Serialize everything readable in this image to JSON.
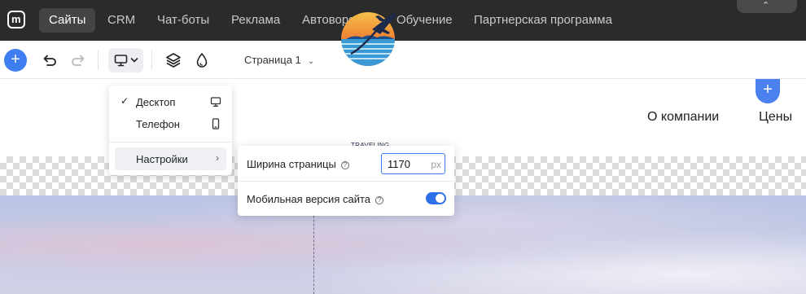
{
  "topnav": {
    "logo_letter": "m",
    "items": [
      {
        "label": "Сайты",
        "active": true
      },
      {
        "label": "CRM",
        "active": false
      },
      {
        "label": "Чат-боты",
        "active": false
      },
      {
        "label": "Реклама",
        "active": false
      },
      {
        "label": "Автоворонки",
        "active": false
      },
      {
        "label": "Обучение",
        "active": false
      },
      {
        "label": "Партнерская программа",
        "active": false
      }
    ],
    "collapse_glyph": "⌃"
  },
  "toolbar": {
    "add_glyph": "+",
    "page_selector": "Страница 1",
    "accent_color": "#3f7ef0"
  },
  "device_menu": {
    "items": [
      {
        "label": "Десктоп",
        "checked": true,
        "icon": "monitor-icon"
      },
      {
        "label": "Телефон",
        "checked": false,
        "icon": "phone-icon"
      }
    ],
    "settings_label": "Настройки",
    "check_glyph": "✓",
    "arrow_glyph": "›"
  },
  "settings_panel": {
    "page_width_label": "Ширина страницы",
    "page_width_value": "1170",
    "page_width_unit": "px",
    "mobile_label": "Мобильная версия сайта",
    "mobile_enabled": true,
    "help_glyph": "?"
  },
  "site": {
    "brand_name": "TRAVELING",
    "nav_links": [
      "О компании",
      "Цены"
    ],
    "add_glyph": "+"
  }
}
